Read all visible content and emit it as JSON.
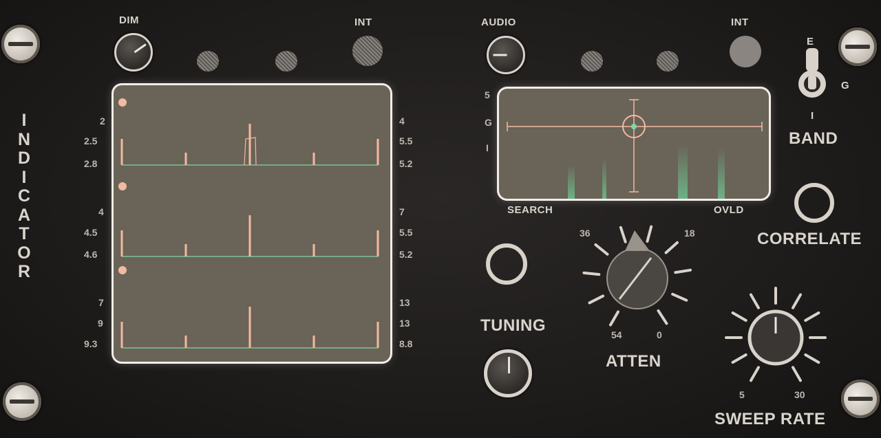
{
  "labels": {
    "dim": "DIM",
    "int_left": "INT",
    "audio": "AUDIO",
    "int_right": "INT",
    "indicator": [
      "I",
      "N",
      "D",
      "I",
      "C",
      "A",
      "T",
      "O",
      "R"
    ],
    "band": "BAND",
    "band_positions": [
      "E",
      "G",
      "I"
    ],
    "search": "SEARCH",
    "ovld": "OVLD",
    "correlate": "CORRELATE",
    "tuning": "TUNING",
    "atten": "ATTEN",
    "atten_scale": [
      "36",
      "18",
      "54",
      "0"
    ],
    "sweep_rate": "SWEEP RATE",
    "sweep_scale": [
      "5",
      "30"
    ],
    "display_side_left": [
      "5",
      "G",
      "I"
    ]
  },
  "indicator_scales": {
    "left": [
      [
        "2",
        "2.5",
        "2.8"
      ],
      [
        "4",
        "4.5",
        "4.6"
      ],
      [
        "7",
        "9",
        "9.3"
      ]
    ],
    "right": [
      [
        "4",
        "5.5",
        "5.2"
      ],
      [
        "7",
        "5.5",
        "5.2"
      ],
      [
        "13",
        "13",
        "8.8"
      ]
    ]
  },
  "traces": [
    {
      "pulse": true
    },
    {
      "pulse": false
    },
    {
      "pulse": false
    }
  ],
  "colors": {
    "marker": "#f3b9a2",
    "trace": "#7fd6a6",
    "screen": "#6a6357"
  }
}
